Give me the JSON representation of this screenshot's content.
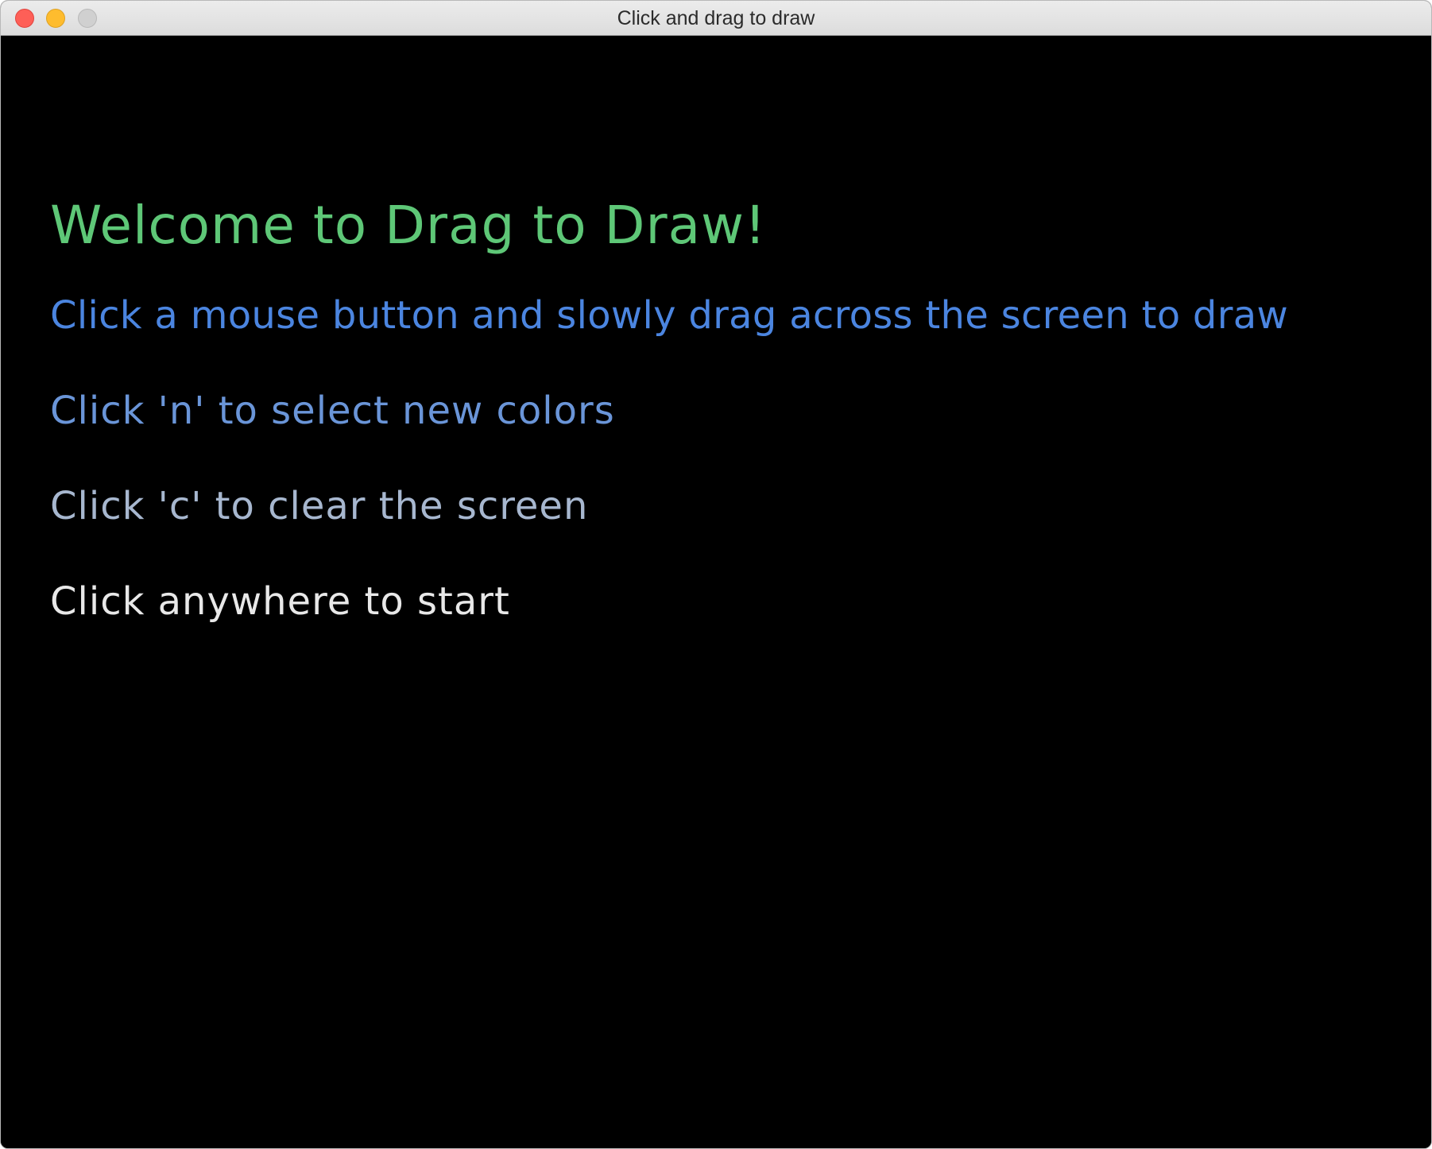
{
  "window": {
    "title": "Click and drag to draw"
  },
  "content": {
    "heading": "Welcome to Drag to Draw!",
    "instructions": [
      "Click a mouse button and slowly drag across the screen to draw",
      "Click 'n' to select new colors",
      "Click 'c' to clear the screen",
      "Click anywhere to start"
    ]
  },
  "colors": {
    "background": "#000000",
    "heading": "#5ec777",
    "instruction_1": "#4b85e0",
    "instruction_2": "#6a95d8",
    "instruction_3": "#a7b7cf",
    "instruction_4": "#e8e8e8"
  }
}
